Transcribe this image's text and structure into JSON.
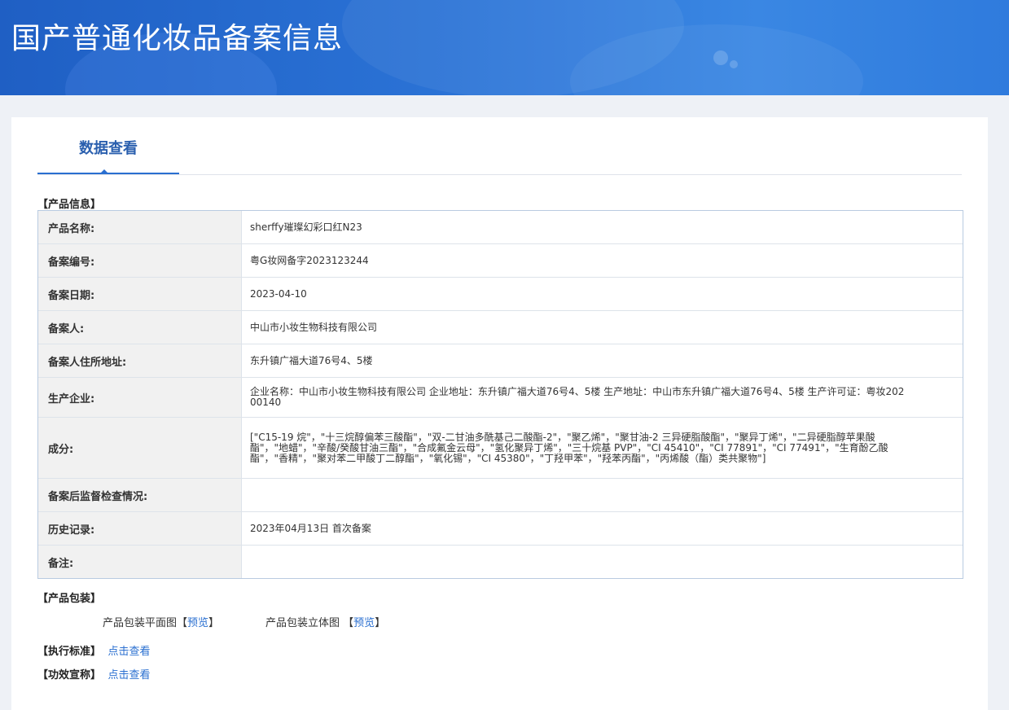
{
  "header": {
    "title": "国产普通化妆品备案信息"
  },
  "tabs": [
    {
      "label": "数据查看"
    }
  ],
  "product_info": {
    "section_title": "【产品信息】",
    "rows": [
      {
        "label": "产品名称:",
        "value": "sherffy璀璨幻彩口红N23"
      },
      {
        "label": "备案编号:",
        "value": "粤G妆网备字2023123244"
      },
      {
        "label": "备案日期:",
        "value": "2023-04-10"
      },
      {
        "label": "备案人:",
        "value": "中山市小妆生物科技有限公司"
      },
      {
        "label": "备案人住所地址:",
        "value": "东升镇广福大道76号4、5楼"
      },
      {
        "label": "生产企业:",
        "value": "企业名称：中山市小妆生物科技有限公司 企业地址：东升镇广福大道76号4、5楼 生产地址：中山市东升镇广福大道76号4、5楼 生产许可证：粤妆20200140"
      },
      {
        "label": "成分:",
        "value": "[\"C15-19 烷\"，\"十三烷醇偏苯三酸酯\"，\"双-二甘油多酰基己二酸酯-2\"，\"聚乙烯\"，\"聚甘油-2 三异硬脂酸酯\"，\"聚异丁烯\"，\"二异硬脂醇苹果酸酯\"，\"地蜡\"，\"辛酸/癸酸甘油三酯\"，\"合成氟金云母\"，\"氢化聚异丁烯\"，\"三十烷基 PVP\"，\"CI 45410\"，\"CI 77891\"，\"CI 77491\"，\"生育酚乙酸酯\"，\"香精\"，\"聚对苯二甲酸丁二醇酯\"，\"氧化锡\"，\"CI 45380\"，\"丁羟甲苯\"，\"羟苯丙酯\"，\"丙烯酸（酯）类共聚物\"]"
      },
      {
        "label": "备案后监督检查情况:",
        "value": ""
      },
      {
        "label": "历史记录:",
        "value": "2023年04月13日 首次备案"
      },
      {
        "label": "备注:",
        "value": ""
      }
    ]
  },
  "packaging": {
    "section_title": "【产品包装】",
    "flat_label": "产品包装平面图",
    "solid_label": "产品包装立体图",
    "bracket_open": "【",
    "bracket_close": "】",
    "preview_link": "预览"
  },
  "standard": {
    "label": "【执行标准】",
    "link": "点击查看"
  },
  "efficacy": {
    "label": "【功效宣称】",
    "link": "点击查看"
  }
}
